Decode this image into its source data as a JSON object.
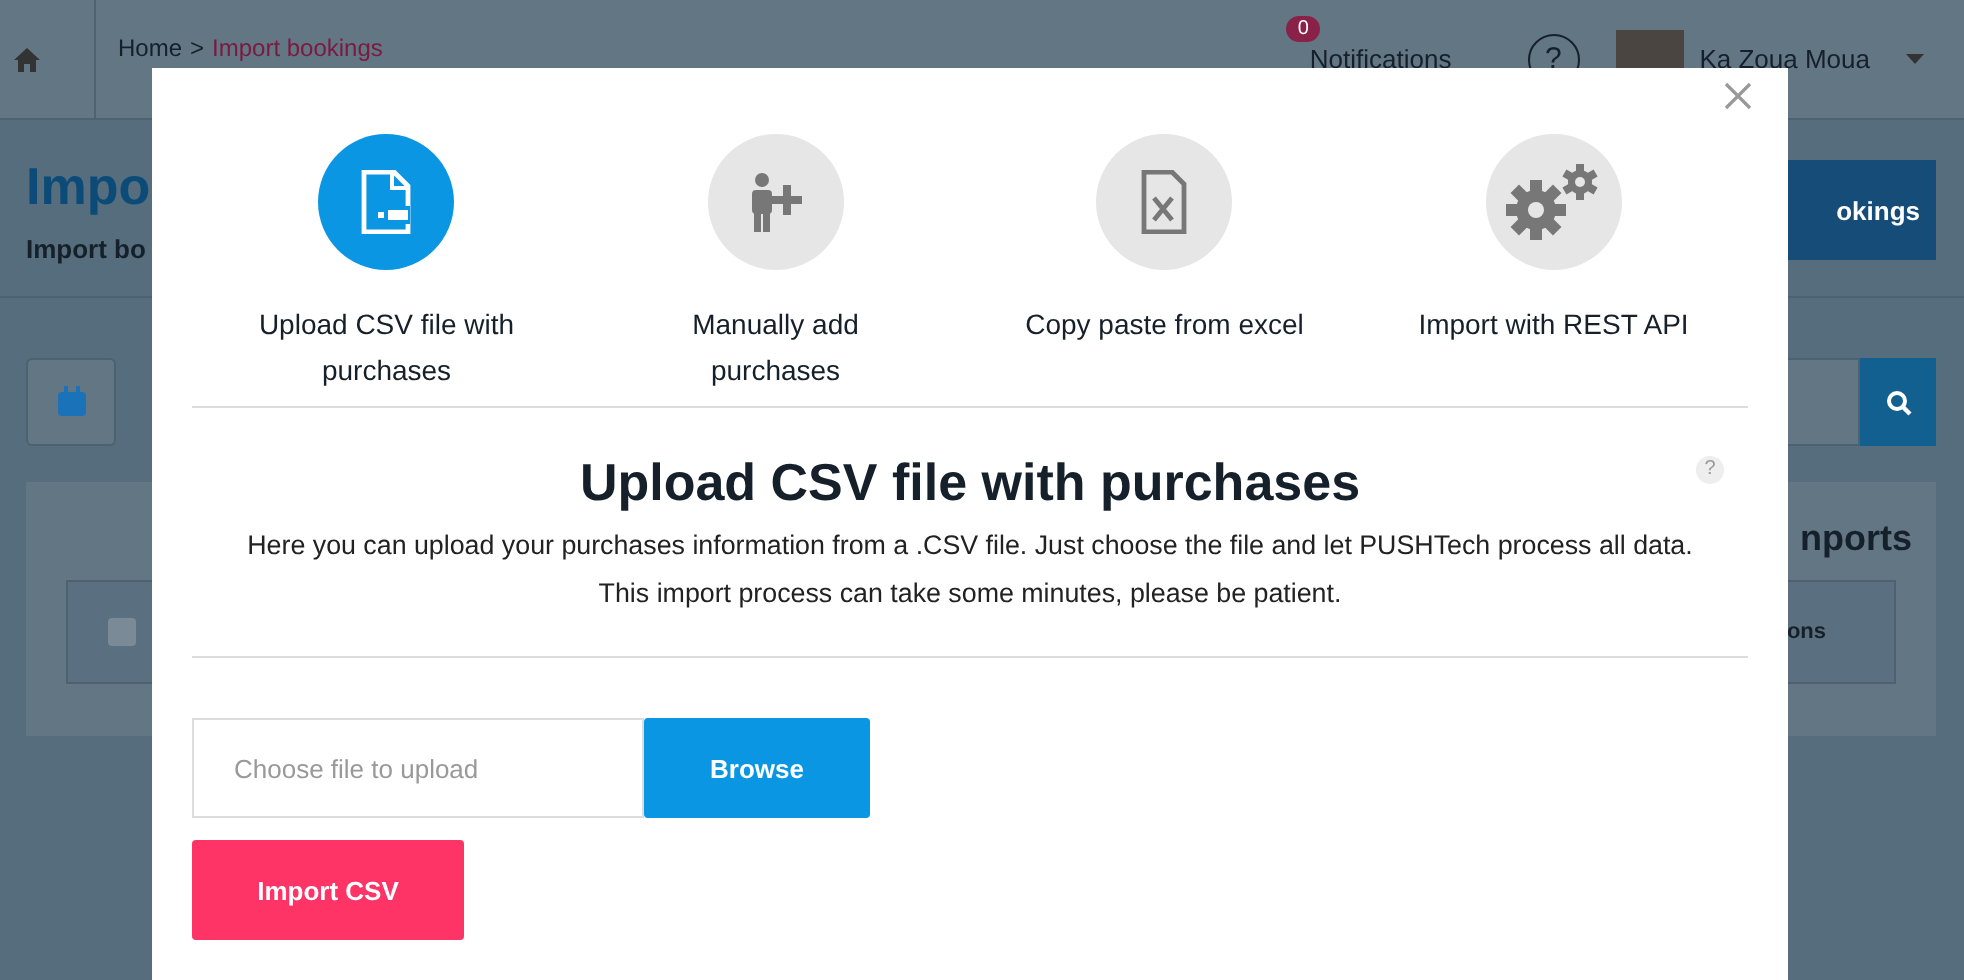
{
  "header": {
    "breadcrumb": [
      {
        "label": "Home"
      },
      {
        "label": "Import bookings"
      }
    ],
    "separator": ">",
    "notifications": {
      "badge": "0",
      "label": "Notifications"
    },
    "help": "?",
    "user": {
      "name": "Ka Zoua Moua"
    }
  },
  "page": {
    "title": "Impo",
    "subtitle": "Import bo",
    "action_button": "okings",
    "card_title": "nports",
    "table_column": "ons",
    "select_all_checked": false
  },
  "modal": {
    "options": [
      {
        "kind": "csv",
        "label": "Upload CSV file with purchases",
        "selected": true
      },
      {
        "kind": "manual",
        "label": "Manually add purchases",
        "selected": false
      },
      {
        "kind": "excel",
        "label": "Copy paste from excel",
        "selected": false
      },
      {
        "kind": "api",
        "label": "Import with REST API",
        "selected": false
      }
    ],
    "help": "?",
    "heading": "Upload CSV file with purchases",
    "description": [
      "Here you can upload your purchases information from a .CSV file. Just choose the file and let PUSHTech process all data.",
      "This import process can take some minutes, please be patient."
    ],
    "file_field": {
      "placeholder": "Choose file to upload"
    },
    "browse_button": "Browse",
    "import_button": "Import CSV"
  }
}
